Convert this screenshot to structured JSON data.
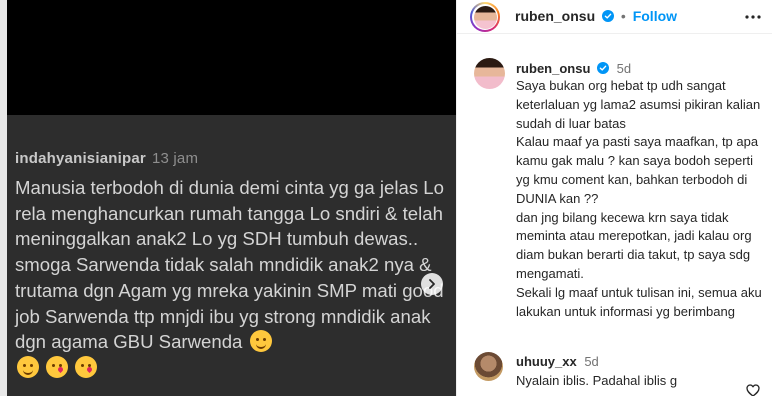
{
  "post": {
    "username": "indahyanisianipar",
    "time": "13 jam",
    "comment": "Manusia terbodoh di dunia demi cinta yg ga jelas Lo rela menghancurkan rumah tangga Lo sndiri & telah meninggalkan anak2 Lo yg SDH tumbuh dewas.. smoga Sarwenda tidak salah mndidik anak2 nya & trutama dgn Agam yg mreka yakinin SMP mati good job Sarwenda ttp mnjdi ibu yg strong mndidik anak dgn agama GBU Sarwenda"
  },
  "header": {
    "username": "ruben_onsu",
    "separator": "•",
    "follow_label": "Follow"
  },
  "comments": [
    {
      "username": "ruben_onsu",
      "time": "5d",
      "text": "Saya bukan org hebat tp udh sangat keterlaluan yg lama2 asumsi pikiran kalian sudah di luar batas\nKalau maaf ya pasti saya maafkan, tp apa kamu gak malu ? kan saya bodoh seperti yg kmu coment kan, bahkan terbodoh di DUNIA kan ??\ndan jng bilang kecewa krn saya tidak meminta atau merepotkan,  jadi kalau org diam bukan berarti dia takut, tp saya sdg mengamati.\nSekali lg maaf untuk tulisan ini, semua aku lakukan untuk informasi yg berimbang"
    },
    {
      "username": "uhuuy_xx",
      "time": "5d",
      "text": "Nyalain iblis. Padahal iblis g"
    }
  ],
  "colors": {
    "accent": "#0095f6",
    "verified": "#0095f6",
    "post_bg": "#2d2d2d",
    "post_text": "#d4d4d4"
  },
  "icons": [
    "verified-icon",
    "more-options-icon",
    "next-arrow-icon",
    "heart-icon",
    "hug-emoji-icon",
    "kiss-emoji-icon"
  ]
}
